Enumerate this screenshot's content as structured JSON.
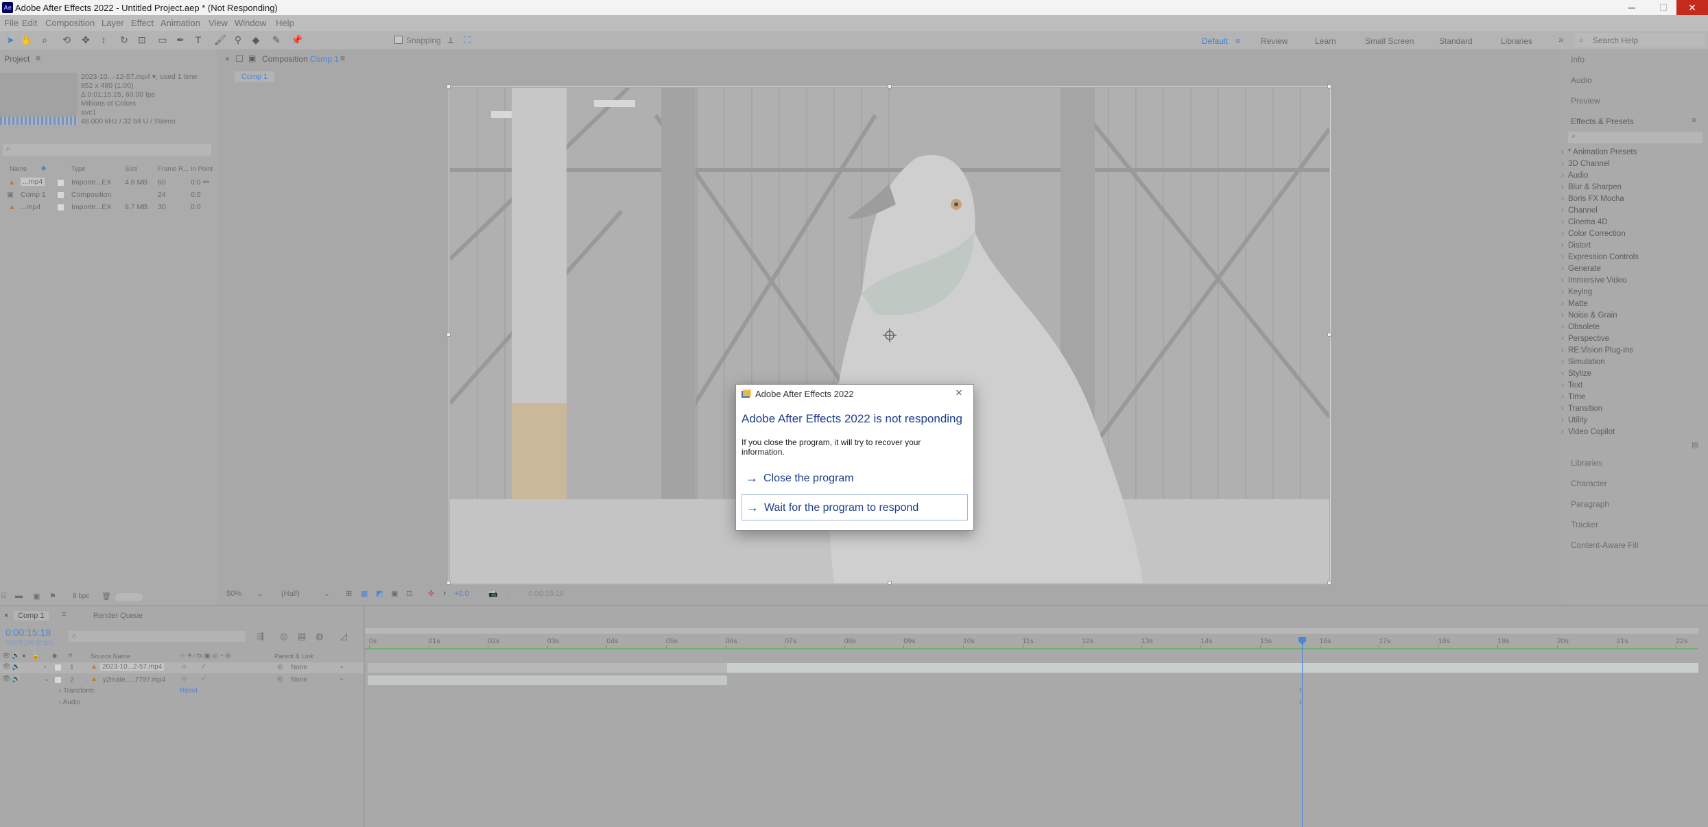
{
  "titlebar": {
    "app_icon": "Ae",
    "title": "Adobe After Effects 2022 - Untitled Project.aep * (Not Responding)",
    "minimize": "─",
    "maximize": "☐",
    "close": "✕"
  },
  "menu": [
    "File",
    "Edit",
    "Composition",
    "Layer",
    "Effect",
    "Animation",
    "View",
    "Window",
    "Help"
  ],
  "toolbar": {
    "snapping": "Snapping",
    "workspaces": [
      "Default",
      "Review",
      "Learn",
      "Small Screen",
      "Standard",
      "Libraries"
    ],
    "search_help": "Search Help"
  },
  "project": {
    "tab": "Project",
    "footage": {
      "name": "2023-10...-12-57.mp4 ▾",
      "used": ", used 1 time",
      "dims": "852 x 480 (1.00)",
      "duration": "Δ 0:01:15:25, 60.00 fps",
      "colors": "Millions of Colors",
      "codec": "avc1",
      "audio": "48.000 kHz / 32 bit U / Stereo"
    },
    "columns": [
      "Name",
      "Type",
      "Size",
      "Frame R...",
      "In Point"
    ],
    "items": [
      {
        "name": "...mp4",
        "type": "Importe...EX",
        "size": "4.8 MB",
        "fps": "60",
        "in": "0:0"
      },
      {
        "name": "Comp 1",
        "type": "Composition",
        "size": "",
        "fps": "24",
        "in": "0:0"
      },
      {
        "name": "...mp4",
        "type": "Importe...EX",
        "size": "8.7 MB",
        "fps": "30",
        "in": "0:0"
      }
    ],
    "bpc": "8 bpc"
  },
  "composition": {
    "tab_label": "Composition",
    "comp_name": "Comp 1",
    "breadcrumb": "Comp 1",
    "zoom": "50%",
    "resolution": "(Half)",
    "exposure": "+0.0",
    "timecode": "0:00:15:18"
  },
  "dialog": {
    "title": "Adobe After Effects 2022",
    "heading": "Adobe After Effects 2022 is not responding",
    "body": "If you close the program, it will try to recover your information.",
    "close_label": "Close the program",
    "wait_label": "Wait for the program to respond",
    "arrow": "→"
  },
  "right_panels": {
    "top": [
      "Info",
      "Audio",
      "Preview"
    ],
    "effects_title": "Effects & Presets",
    "effects": [
      "* Animation Presets",
      "3D Channel",
      "Audio",
      "Blur & Sharpen",
      "Boris FX Mocha",
      "Channel",
      "Cinema 4D",
      "Color Correction",
      "Distort",
      "Expression Controls",
      "Generate",
      "Immersive Video",
      "Keying",
      "Matte",
      "Noise & Grain",
      "Obsolete",
      "Perspective",
      "RE:Vision Plug-ins",
      "Simulation",
      "Stylize",
      "Text",
      "Time",
      "Transition",
      "Utility",
      "Video Copilot"
    ],
    "bottom": [
      "Libraries",
      "Character",
      "Paragraph",
      "Tracker",
      "Content-Aware Fill"
    ]
  },
  "timeline": {
    "tabs": [
      "Comp 1",
      "Render Queue"
    ],
    "timecode": "0:00:15:18",
    "frame_info": "00378 (24.00 fps)",
    "col_source": "Source Name",
    "col_parent": "Parent & Link",
    "layers": [
      {
        "num": "1",
        "name": "2023-10...2-57.mp4",
        "parent": "None"
      },
      {
        "num": "2",
        "name": "y2mate.....7797.mp4",
        "parent": "None"
      }
    ],
    "props": [
      "Transform",
      "Audio"
    ],
    "reset": "Reset",
    "ticks": [
      "0s",
      "01s",
      "02s",
      "03s",
      "04s",
      "05s",
      "06s",
      "07s",
      "08s",
      "09s",
      "10s",
      "11s",
      "12s",
      "13s",
      "14s",
      "15s",
      "16s",
      "17s",
      "18s",
      "19s",
      "20s",
      "21s",
      "22s"
    ],
    "playhead_label": "16s"
  },
  "colors": {
    "accent": "#4a86d8",
    "dialog_link": "#1c3d8c",
    "close_red": "#c42b1c"
  }
}
